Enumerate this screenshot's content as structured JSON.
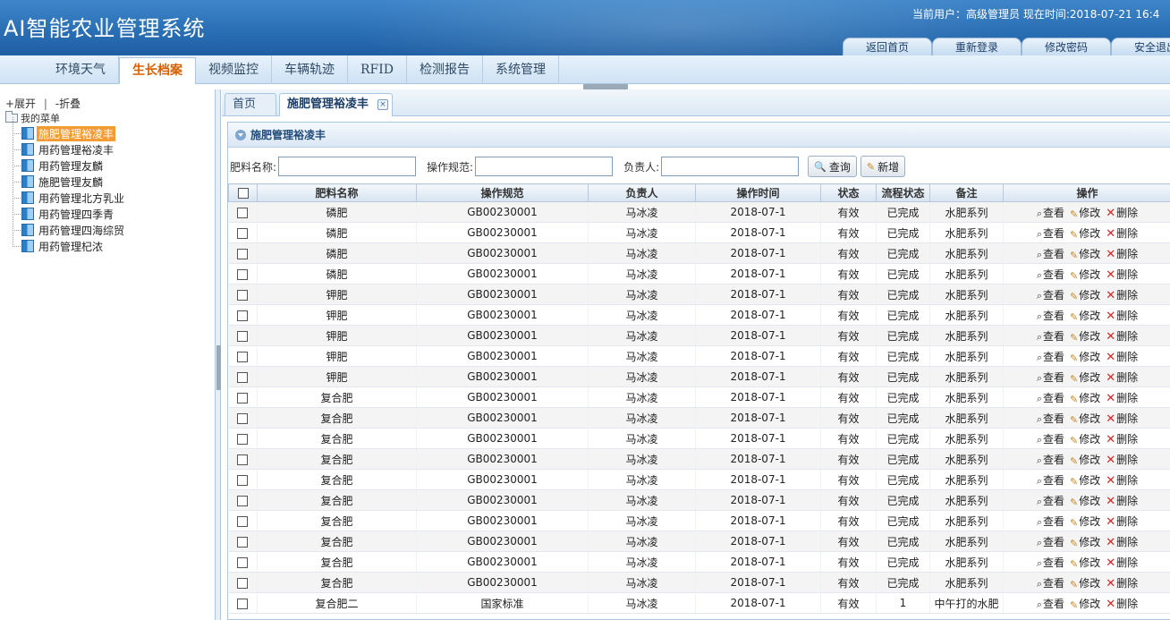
{
  "app": {
    "title": "AI智能农业管理系统"
  },
  "user_info": "当前用户：高级管理员  现在时间:2018-07-21  16:4",
  "header_links": [
    "返回首页",
    "重新登录",
    "修改密码",
    "安全退出"
  ],
  "nav": {
    "tabs": [
      "环境天气",
      "生长档案",
      "视频监控",
      "车辆轨迹",
      "RFID",
      "检测报告",
      "系统管理"
    ],
    "active": "生长档案"
  },
  "sidebar": {
    "expand_label": "+展开",
    "divider": "|",
    "collapse_label": "-折叠",
    "root_label": "我的菜单",
    "items": [
      {
        "label": "施肥管理裕凌丰",
        "selected": true
      },
      {
        "label": "用药管理裕凌丰"
      },
      {
        "label": "用药管理友麟"
      },
      {
        "label": "施肥管理友麟"
      },
      {
        "label": "用药管理北方乳业"
      },
      {
        "label": "用药管理四季青"
      },
      {
        "label": "用药管理四海综贸"
      },
      {
        "label": "用药管理杞浓"
      }
    ]
  },
  "content_tabs": {
    "home": "首页",
    "active": "施肥管理裕凌丰",
    "close_symbol": "×"
  },
  "panel": {
    "title": "施肥管理裕凌丰"
  },
  "search": {
    "fertilizer_label": "肥料名称:",
    "spec_label": "操作规范:",
    "owner_label": "负责人:",
    "query_button": "查询",
    "add_button": "新增"
  },
  "table": {
    "columns": [
      "肥料名称",
      "操作规范",
      "负责人",
      "操作时间",
      "状态",
      "流程状态",
      "备注",
      "操作"
    ],
    "actions": {
      "view": "查看",
      "edit": "修改",
      "delete": "删除"
    },
    "rows": [
      [
        "磷肥",
        "GB00230001",
        "马冰凌",
        "2018-07-1",
        "有效",
        "已完成",
        "水肥系列"
      ],
      [
        "磷肥",
        "GB00230001",
        "马冰凌",
        "2018-07-1",
        "有效",
        "已完成",
        "水肥系列"
      ],
      [
        "磷肥",
        "GB00230001",
        "马冰凌",
        "2018-07-1",
        "有效",
        "已完成",
        "水肥系列"
      ],
      [
        "磷肥",
        "GB00230001",
        "马冰凌",
        "2018-07-1",
        "有效",
        "已完成",
        "水肥系列"
      ],
      [
        "钾肥",
        "GB00230001",
        "马冰凌",
        "2018-07-1",
        "有效",
        "已完成",
        "水肥系列"
      ],
      [
        "钾肥",
        "GB00230001",
        "马冰凌",
        "2018-07-1",
        "有效",
        "已完成",
        "水肥系列"
      ],
      [
        "钾肥",
        "GB00230001",
        "马冰凌",
        "2018-07-1",
        "有效",
        "已完成",
        "水肥系列"
      ],
      [
        "钾肥",
        "GB00230001",
        "马冰凌",
        "2018-07-1",
        "有效",
        "已完成",
        "水肥系列"
      ],
      [
        "钾肥",
        "GB00230001",
        "马冰凌",
        "2018-07-1",
        "有效",
        "已完成",
        "水肥系列"
      ],
      [
        "复合肥",
        "GB00230001",
        "马冰凌",
        "2018-07-1",
        "有效",
        "已完成",
        "水肥系列"
      ],
      [
        "复合肥",
        "GB00230001",
        "马冰凌",
        "2018-07-1",
        "有效",
        "已完成",
        "水肥系列"
      ],
      [
        "复合肥",
        "GB00230001",
        "马冰凌",
        "2018-07-1",
        "有效",
        "已完成",
        "水肥系列"
      ],
      [
        "复合肥",
        "GB00230001",
        "马冰凌",
        "2018-07-1",
        "有效",
        "已完成",
        "水肥系列"
      ],
      [
        "复合肥",
        "GB00230001",
        "马冰凌",
        "2018-07-1",
        "有效",
        "已完成",
        "水肥系列"
      ],
      [
        "复合肥",
        "GB00230001",
        "马冰凌",
        "2018-07-1",
        "有效",
        "已完成",
        "水肥系列"
      ],
      [
        "复合肥",
        "GB00230001",
        "马冰凌",
        "2018-07-1",
        "有效",
        "已完成",
        "水肥系列"
      ],
      [
        "复合肥",
        "GB00230001",
        "马冰凌",
        "2018-07-1",
        "有效",
        "已完成",
        "水肥系列"
      ],
      [
        "复合肥",
        "GB00230001",
        "马冰凌",
        "2018-07-1",
        "有效",
        "已完成",
        "水肥系列"
      ],
      [
        "复合肥",
        "GB00230001",
        "马冰凌",
        "2018-07-1",
        "有效",
        "已完成",
        "水肥系列"
      ],
      [
        "复合肥二",
        "国家标准",
        "马冰凌",
        "2018-07-1",
        "有效",
        "1",
        "中午打的水肥"
      ]
    ]
  },
  "colors": {
    "header_blue": "#2a6fb4",
    "active_tab_text": "#d65f00",
    "selected_tree_bg": "#f39c34",
    "delete_red": "#e0221c"
  }
}
